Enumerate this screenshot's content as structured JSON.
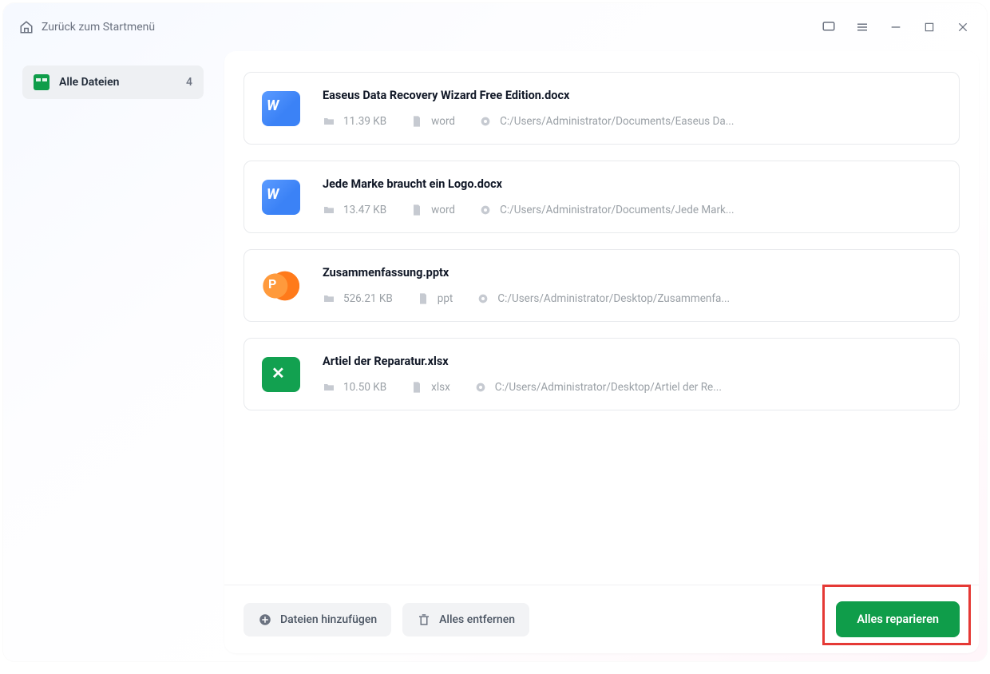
{
  "titlebar": {
    "back_label": "Zurück zum Startmenü"
  },
  "sidebar": {
    "item_label": "Alle Dateien",
    "item_count": "4"
  },
  "files": [
    {
      "name": "Easeus Data Recovery Wizard Free Edition.docx",
      "size": "11.39 KB",
      "type": "word",
      "path": "C:/Users/Administrator/Documents/Easeus Da...",
      "icon": "word"
    },
    {
      "name": "Jede Marke braucht ein Logo.docx",
      "size": "13.47 KB",
      "type": "word",
      "path": "C:/Users/Administrator/Documents/Jede Mark...",
      "icon": "word"
    },
    {
      "name": "Zusammenfassung.pptx",
      "size": "526.21 KB",
      "type": "ppt",
      "path": "C:/Users/Administrator/Desktop/Zusammenfa...",
      "icon": "ppt"
    },
    {
      "name": "Artiel der Reparatur.xlsx",
      "size": "10.50 KB",
      "type": "xlsx",
      "path": "C:/Users/Administrator/Desktop/Artiel der Re...",
      "icon": "xls"
    }
  ],
  "footer": {
    "add_label": "Dateien hinzufügen",
    "remove_label": "Alles entfernen",
    "repair_label": "Alles reparieren"
  }
}
